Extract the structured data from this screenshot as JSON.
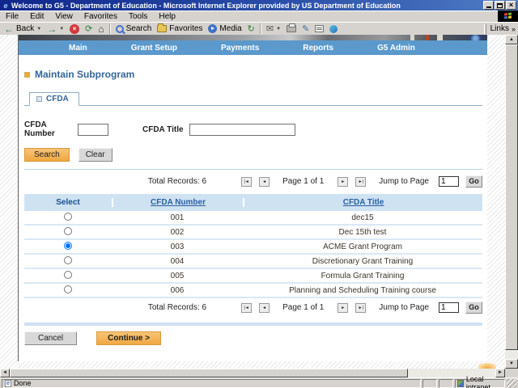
{
  "window": {
    "title": "Welcome to G5 - Department of Education - Microsoft Internet Explorer provided by US Department of Education"
  },
  "menu": {
    "items": [
      "File",
      "Edit",
      "View",
      "Favorites",
      "Tools",
      "Help"
    ]
  },
  "toolbar": {
    "back": "Back",
    "search": "Search",
    "favorites": "Favorites",
    "media": "Media",
    "links": "Links",
    "links_chevron": "»"
  },
  "nav": {
    "items": [
      "Main",
      "Grant Setup",
      "Payments",
      "Reports",
      "G5 Admin"
    ]
  },
  "page": {
    "heading": "Maintain Subprogram",
    "tab": "CFDA",
    "form": {
      "number_label": "CFDA Number",
      "number_value": "",
      "title_label": "CFDA Title",
      "title_value": "",
      "search": "Search",
      "clear": "Clear"
    },
    "pagination": {
      "total": "Total Records: 6",
      "first": "|◄",
      "prev": "◄",
      "page": "Page 1 of 1",
      "next": "►",
      "last": "►|",
      "jump": "Jump to Page",
      "jump_value": "1",
      "go": "Go"
    },
    "table": {
      "headers": {
        "select": "Select",
        "number": "CFDA Number",
        "title": "CFDA Title"
      },
      "rows": [
        {
          "number": "001",
          "title": "dec15",
          "selected": false
        },
        {
          "number": "002",
          "title": "Dec 15th test",
          "selected": false
        },
        {
          "number": "003",
          "title": "ACME Grant Program",
          "selected": true
        },
        {
          "number": "004",
          "title": "Discretionary Grant Training",
          "selected": false
        },
        {
          "number": "005",
          "title": "Formula Grant Training",
          "selected": false
        },
        {
          "number": "006",
          "title": "Planning and Scheduling Training course",
          "selected": false
        }
      ]
    },
    "actions": {
      "cancel": "Cancel",
      "continue": "Continue >"
    }
  },
  "status": {
    "text": "Done",
    "zone": "Local intranet"
  },
  "colors": {
    "title_blue": "#2a4fa8",
    "nav_blue": "#5b99cc",
    "link_blue": "#336699",
    "table_header_bg": "#cfe2f2",
    "row_divider": "#d9e8f5",
    "button_orange": "#f0a840",
    "chrome_gray": "#d6d3ce"
  }
}
